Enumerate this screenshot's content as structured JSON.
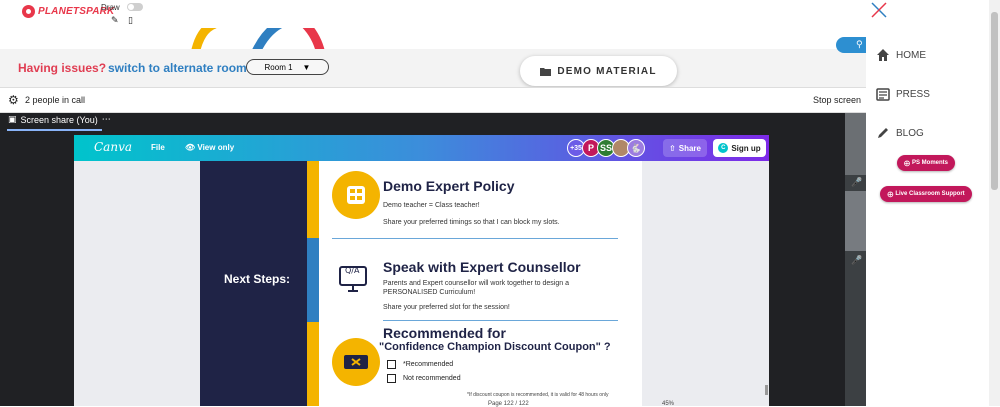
{
  "app": {
    "logo_text": "PLANETSPARK",
    "draw_label": "Draw"
  },
  "issues_bar": {
    "issue_text": "Having issues?",
    "alt_room_link": "switch to alternate room",
    "room_value": "Room 1",
    "demo_button": "DEMO MATERIAL"
  },
  "meet": {
    "people_count": "2 people in call",
    "stop_share": "Stop screen",
    "share_tab": "Screen share (You)",
    "share_tab_menu": "⋯"
  },
  "canva": {
    "logo": "Canva",
    "file": "File",
    "view_only": "View only",
    "avatar_count": "+35",
    "avatars": [
      "P",
      "SS"
    ],
    "share": "Share",
    "signup": "Sign up"
  },
  "slide": {
    "next_steps": "Next Steps:",
    "sections": [
      {
        "title": "Demo Expert Policy",
        "lines": [
          "Demo teacher = Class teacher!",
          "Share your preferred timings so that I can block my slots."
        ]
      },
      {
        "title": "Speak with Expert Counsellor",
        "lines": [
          "Parents and Expert counsellor will work together to design a",
          "PERSONALISED Curriculum!",
          "Share your preferred slot for the session!"
        ]
      },
      {
        "title": "Recommended for",
        "subtitle": "\"Confidence Champion Discount Coupon\" ?",
        "options": [
          "*Recommended",
          "Not recommended"
        ]
      }
    ],
    "footnote": "*If discount coupon is recommended, it is valid for 48 hours only",
    "page_indicator": "Page 122 / 122",
    "zoom": "45%"
  },
  "side_menu": {
    "items": [
      "HOME",
      "PRESS",
      "BLOG"
    ],
    "pill_ps_moments": "PS Moments",
    "pill_live_support": "Live Classroom Support"
  },
  "colors": {
    "brand_red": "#e8374a",
    "link_blue": "#2f7fc1",
    "pill_pink": "#c2185b",
    "slide_navy": "#1f2346",
    "accent_yellow": "#f4b400"
  }
}
